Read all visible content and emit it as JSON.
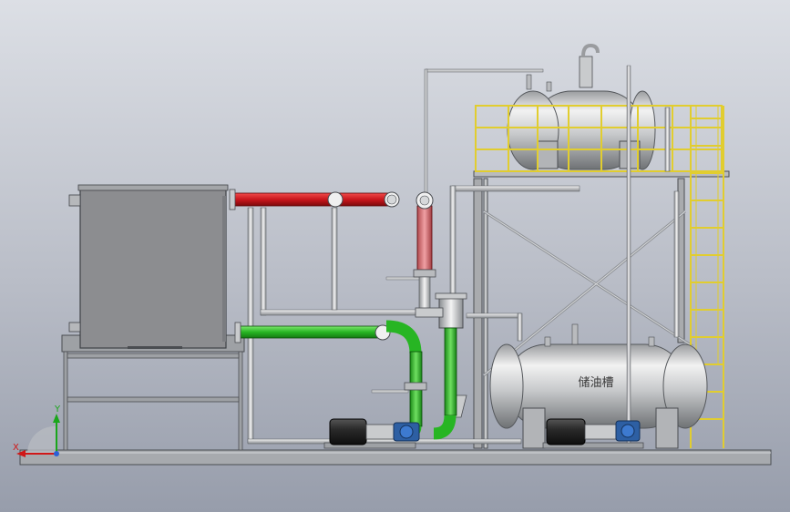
{
  "tank_label": "储油槽",
  "axes": {
    "x": "X",
    "y": "Y"
  },
  "colors": {
    "bg_top": "#d9dce2",
    "bg_bottom": "#9aa0ad",
    "hot_pipe": "#c8141b",
    "return_pipe": "#2fc02a",
    "ladder": "#e6d23c",
    "frame": "#8f9297",
    "tank": "#c9cbcd"
  }
}
